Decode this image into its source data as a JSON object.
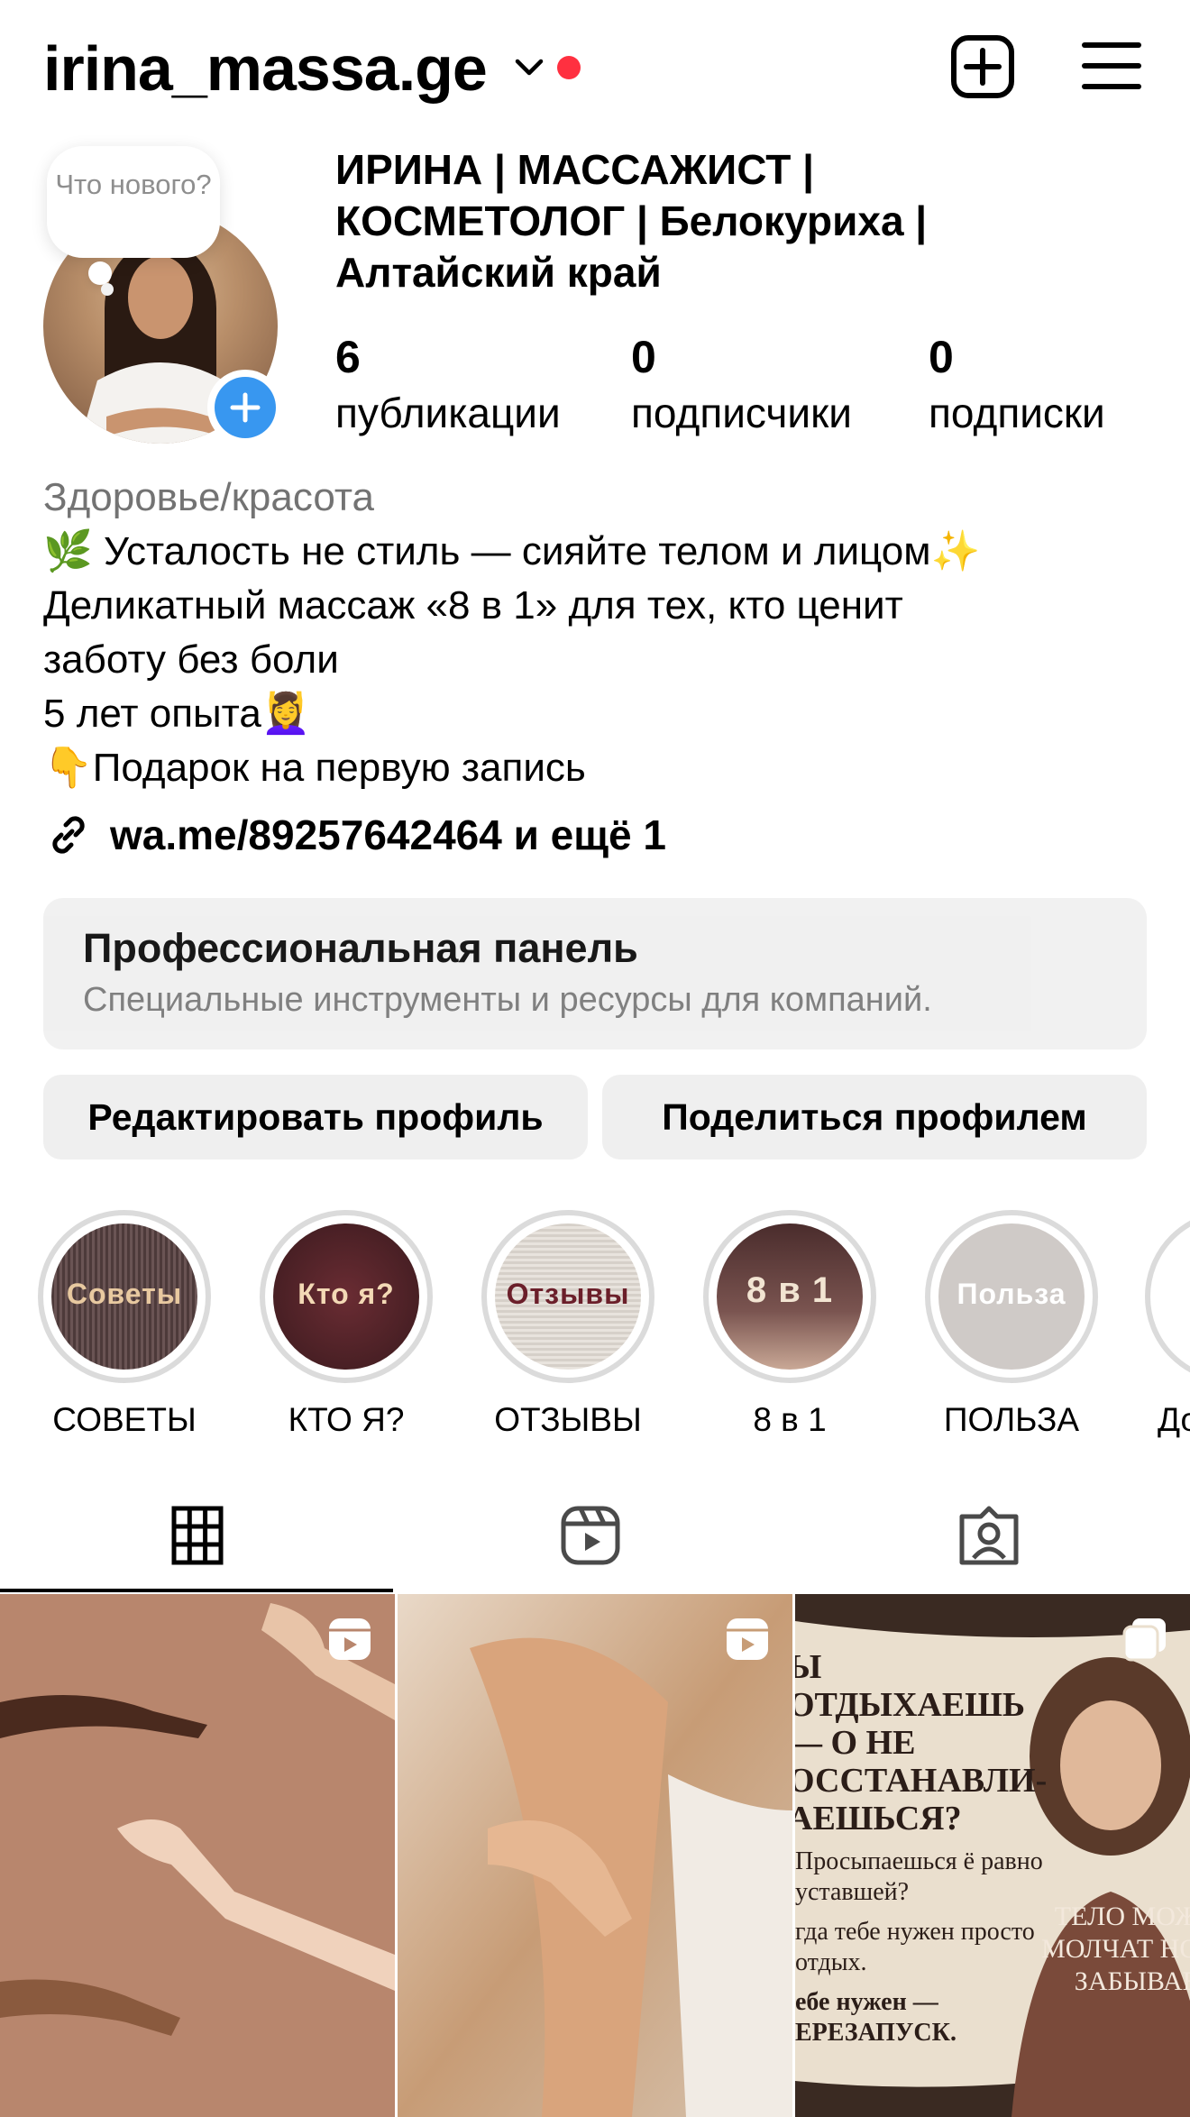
{
  "header": {
    "username": "irina_massa.ge",
    "icons": [
      "chevron-down-icon",
      "notification-dot",
      "add-post-icon",
      "menu-icon"
    ]
  },
  "profile": {
    "bubble_text": "Что нового?",
    "full_name": "ИРИНА | МАССАЖИСТ | КОСМЕТОЛОГ | Белокуриха | Алтайский край",
    "stats": [
      {
        "value": "6",
        "label": "публикации"
      },
      {
        "value": "0",
        "label": "подписчики"
      },
      {
        "value": "0",
        "label": "подписки"
      }
    ],
    "category": "Здоровье/красота",
    "bio_lines": [
      "🌿 Усталость не стиль — сияйте телом и лицом✨",
      "Деликатный массаж «8 в 1» для тех, кто ценит",
      "заботу без боли",
      "5 лет опыта💆‍♀️",
      "👇Подарок на первую запись"
    ],
    "link": "wa.me/89257642464 и ещё 1"
  },
  "pro_dashboard": {
    "title": "Профессиональная панель",
    "subtitle": "Специальные инструменты и ресурсы для компаний."
  },
  "buttons": {
    "edit": "Редактировать профиль",
    "share": "Поделиться профилем"
  },
  "highlights": [
    {
      "cover": "Советы",
      "label": "СОВЕТЫ",
      "color": "#5a4646",
      "text_color": "#e8c9a0"
    },
    {
      "cover": "Кто я?",
      "label": "КТО Я?",
      "color": "#4a2428",
      "text_color": "#f3d9b5"
    },
    {
      "cover": "Отзывы",
      "label": "ОТЗЫВЫ",
      "color": "#e4dfd9",
      "text_color": "#6b1f2a"
    },
    {
      "cover": "8 в 1",
      "label": "8 в 1",
      "color": "#5b3b3b",
      "text_color": "#f2e4d2"
    },
    {
      "cover": "Польза",
      "label": "ПОЛЬЗА",
      "color": "#cfcac7",
      "text_color": "#ffffff"
    },
    {
      "cover": "",
      "label": "До",
      "color": "#ffffff",
      "text_color": "#000000"
    }
  ],
  "tabs": [
    "grid-icon",
    "reels-icon",
    "tagged-icon"
  ],
  "posts": {
    "post3_title": "Ы ОТДЫХАЕШЬ — О НЕ ОССТАНАВЛИ- АЕШЬСЯ?",
    "post3_body1": "Просыпаешься ё равно уставшей?",
    "post3_body2": "гда тебе нужен просто отдых.",
    "post3_body3": "ебе нужен — ЕРЕЗАПУСК.",
    "post3_side": "ТЕЛО МОЖ МОЛЧАТ НО ЗАБЫВАЕ"
  }
}
